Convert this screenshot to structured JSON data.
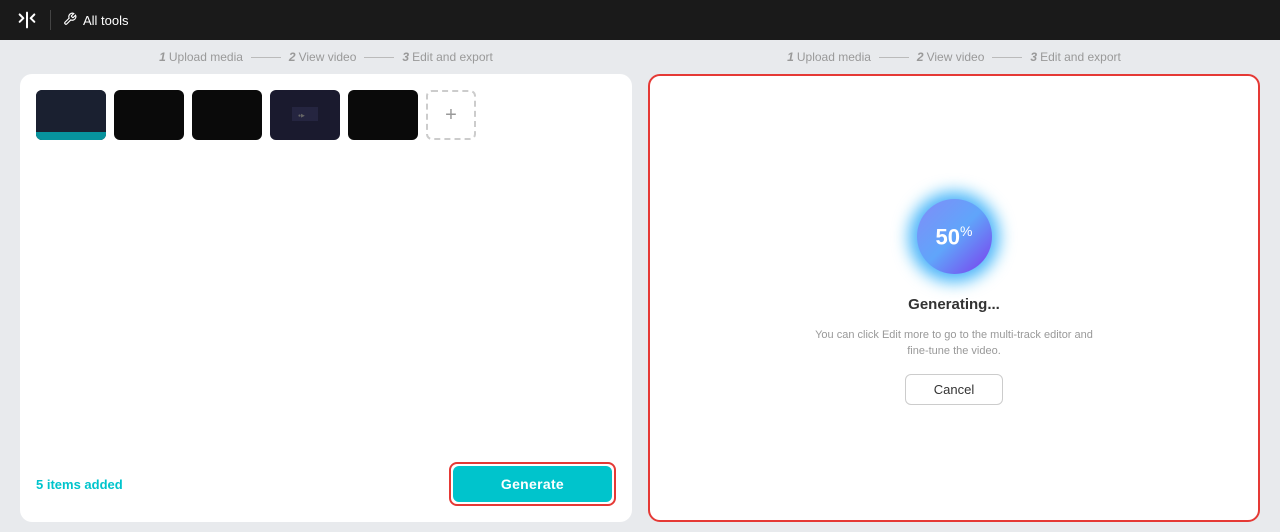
{
  "navbar": {
    "logo_icon": "wondershare-icon",
    "divider": true,
    "tools_label": "All tools",
    "tools_icon": "tools-icon"
  },
  "left_panel": {
    "stepper": {
      "step1": {
        "num": "1",
        "label": "Upload media",
        "active": false
      },
      "step2": {
        "num": "2",
        "label": "View video",
        "active": false
      },
      "step3": {
        "num": "3",
        "label": "Edit and export",
        "active": false
      }
    },
    "thumbnails": [
      {
        "id": 1,
        "label": "thumb-1"
      },
      {
        "id": 2,
        "label": "thumb-2"
      },
      {
        "id": 3,
        "label": "thumb-3"
      },
      {
        "id": 4,
        "label": "thumb-4"
      },
      {
        "id": 5,
        "label": "thumb-5"
      }
    ],
    "add_button_label": "+",
    "items_count": "5",
    "items_label": "items added",
    "generate_label": "Generate"
  },
  "right_panel": {
    "stepper": {
      "step1": {
        "num": "1",
        "label": "Upload media",
        "active": false
      },
      "step2": {
        "num": "2",
        "label": "View video",
        "active": false
      },
      "step3": {
        "num": "3",
        "label": "Edit and export",
        "active": false
      }
    },
    "progress_percent": "50",
    "progress_symbol": "%",
    "generating_title": "Generating...",
    "generating_sub": "You can click Edit more to go to the multi-track editor and fine-tune the video.",
    "cancel_label": "Cancel"
  }
}
